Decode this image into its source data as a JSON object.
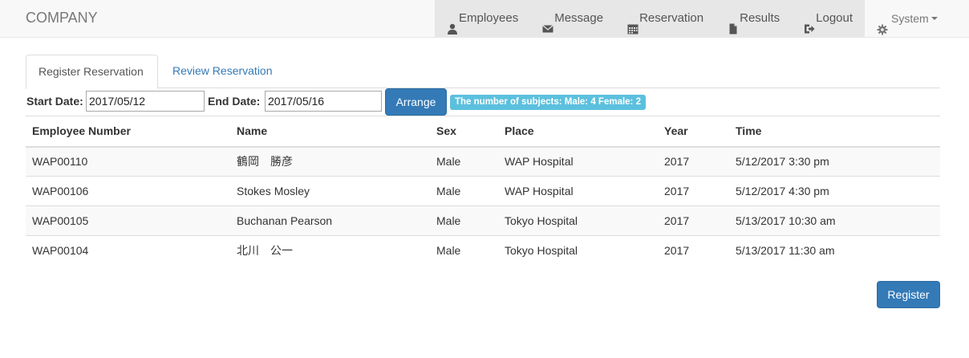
{
  "brand": "COMPANY",
  "nav": {
    "employees": "Employees",
    "message": "Message",
    "reservation": "Reservation",
    "results": "Results",
    "logout": "Logout",
    "system": "System"
  },
  "tabs": {
    "register": "Register Reservation",
    "review": "Review Reservation"
  },
  "filters": {
    "start_label": "Start Date:",
    "start_value": "2017/05/12",
    "end_label": "End Date:",
    "end_value": "2017/05/16",
    "arrange_label": "Arrange",
    "subjects_badge": "The number of subjects: Male: 4 Female: 2"
  },
  "table": {
    "headers": [
      "Employee Number",
      "Name",
      "Sex",
      "Place",
      "Year",
      "Time"
    ],
    "rows": [
      [
        "WAP00110",
        "鶴岡　勝彦",
        "Male",
        "WAP Hospital",
        "2017",
        "5/12/2017 3:30 pm"
      ],
      [
        "WAP00106",
        "Stokes Mosley",
        "Male",
        "WAP Hospital",
        "2017",
        "5/12/2017 4:30 pm"
      ],
      [
        "WAP00105",
        "Buchanan Pearson",
        "Male",
        "Tokyo Hospital",
        "2017",
        "5/13/2017 10:30 am"
      ],
      [
        "WAP00104",
        "北川　公一",
        "Male",
        "Tokyo Hospital",
        "2017",
        "5/13/2017 11:30 am"
      ]
    ]
  },
  "register_label": "Register",
  "colors": {
    "primary": "#337ab7",
    "badge": "#5bc0de",
    "navbar": "#f8f8f8",
    "nav_active": "#e7e7e7"
  },
  "icons": {
    "employees": "user-icon",
    "message": "envelope-icon",
    "reservation": "calendar-icon",
    "results": "file-icon",
    "logout": "logout-icon",
    "system": "gear-icon"
  }
}
